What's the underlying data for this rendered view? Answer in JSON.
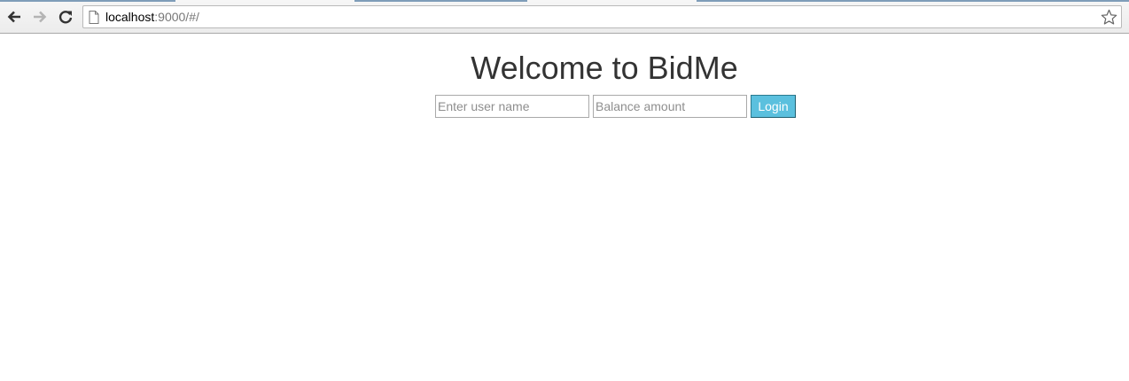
{
  "browser": {
    "url_host": "localhost",
    "url_rest": ":9000/#/",
    "icons": {
      "back": "back-arrow-icon",
      "forward": "forward-arrow-icon",
      "reload": "reload-icon",
      "page": "page-icon",
      "bookmark": "star-icon"
    }
  },
  "page": {
    "title": "Welcome to BidMe",
    "form": {
      "username_placeholder": "Enter user name",
      "balance_placeholder": "Balance amount",
      "login_label": "Login"
    }
  },
  "colors": {
    "heading": "#333333",
    "button_bg": "#5bc0de",
    "button_text": "#ffffff"
  }
}
